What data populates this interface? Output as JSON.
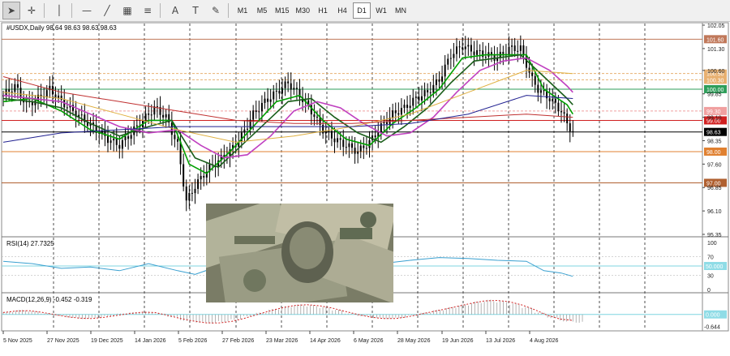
{
  "toolbar": {
    "tools": [
      {
        "icon": "cursor-arrow-icon",
        "glyph": "➤",
        "active": true
      },
      {
        "icon": "crosshair-icon",
        "glyph": "✛",
        "active": false
      },
      {
        "icon": "vertical-line-icon",
        "glyph": "│",
        "active": false
      },
      {
        "icon": "horizontal-line-icon",
        "glyph": "—",
        "active": false
      },
      {
        "icon": "trendline-icon",
        "glyph": "╱",
        "active": false
      },
      {
        "icon": "channel-icon",
        "glyph": "▦",
        "active": false
      },
      {
        "icon": "fibonacci-icon",
        "glyph": "≡",
        "active": false
      },
      {
        "icon": "text-icon",
        "glyph": "A",
        "active": false
      },
      {
        "icon": "text-label-icon",
        "glyph": "T",
        "active": false
      },
      {
        "icon": "shapes-icon",
        "glyph": "✎",
        "active": false
      }
    ],
    "timeframes": [
      {
        "label": "M1",
        "active": false
      },
      {
        "label": "M5",
        "active": false
      },
      {
        "label": "M15",
        "active": false
      },
      {
        "label": "M30",
        "active": false
      },
      {
        "label": "H1",
        "active": false
      },
      {
        "label": "H4",
        "active": false
      },
      {
        "label": "D1",
        "active": true
      },
      {
        "label": "W1",
        "active": false
      },
      {
        "label": "MN",
        "active": false
      }
    ]
  },
  "chart_data": [
    {
      "type": "line",
      "title": "#USDX,Daily  98.64 98.63 98.63 98.63",
      "ylim": [
        95.35,
        102.05
      ],
      "yticks": [
        95.35,
        96.1,
        96.85,
        97.6,
        98.35,
        99.1,
        99.85,
        100.6,
        101.3,
        102.05
      ],
      "price_markers": [
        {
          "value": 101.6,
          "label": "101.60",
          "color": "#c0785a"
        },
        {
          "value": 100.5,
          "label": "100.50",
          "color": "#e8b070"
        },
        {
          "value": 100.3,
          "label": "100.30",
          "color": "#e8b070"
        },
        {
          "value": 100.0,
          "label": "100.00",
          "color": "#2e9e5a"
        },
        {
          "value": 99.3,
          "label": "99.30",
          "color": "#f0a0a0"
        },
        {
          "value": 99.0,
          "label": "99.00",
          "color": "#d02020"
        },
        {
          "value": 98.63,
          "label": "98.63",
          "color": "#000000"
        },
        {
          "value": 98.0,
          "label": "98.00",
          "color": "#e08030"
        },
        {
          "value": 97.0,
          "label": "97.00",
          "color": "#b06030"
        }
      ],
      "x_labels": [
        "5 Nov 2025",
        "27 Nov 2025",
        "19 Dec 2025",
        "14 Jan 2026",
        "5 Feb 2026",
        "27 Feb 2026",
        "23 Mar 2026",
        "14 Apr 2026",
        "6 May 2026",
        "28 May 2026",
        "19 Jun 2026",
        "13 Jul 2026",
        "4 Aug 2026"
      ],
      "close_path": [
        [
          0,
          99.8
        ],
        [
          4,
          100.1
        ],
        [
          8,
          99.5
        ],
        [
          12,
          99.7
        ],
        [
          16,
          100.0
        ],
        [
          20,
          99.6
        ],
        [
          24,
          99.3
        ],
        [
          28,
          99.0
        ],
        [
          32,
          98.7
        ],
        [
          36,
          98.4
        ],
        [
          40,
          98.2
        ],
        [
          44,
          98.6
        ],
        [
          48,
          99.0
        ],
        [
          52,
          99.4
        ],
        [
          56,
          99.1
        ],
        [
          60,
          98.2
        ],
        [
          63,
          96.4
        ],
        [
          66,
          96.9
        ],
        [
          70,
          97.4
        ],
        [
          74,
          97.7
        ],
        [
          78,
          98.0
        ],
        [
          82,
          98.5
        ],
        [
          86,
          99.2
        ],
        [
          90,
          99.6
        ],
        [
          94,
          99.9
        ],
        [
          98,
          100.2
        ],
        [
          102,
          99.8
        ],
        [
          106,
          99.3
        ],
        [
          110,
          98.7
        ],
        [
          114,
          98.4
        ],
        [
          118,
          98.2
        ],
        [
          122,
          98.0
        ],
        [
          126,
          98.3
        ],
        [
          130,
          98.8
        ],
        [
          134,
          99.2
        ],
        [
          138,
          99.4
        ],
        [
          142,
          99.7
        ],
        [
          146,
          99.9
        ],
        [
          150,
          100.3
        ],
        [
          154,
          101.1
        ],
        [
          158,
          101.4
        ],
        [
          162,
          101.2
        ],
        [
          166,
          101.1
        ],
        [
          170,
          101.0
        ],
        [
          174,
          101.3
        ],
        [
          178,
          101.3
        ],
        [
          182,
          100.3
        ],
        [
          184,
          100.0
        ],
        [
          188,
          99.7
        ],
        [
          192,
          99.3
        ],
        [
          194,
          98.9
        ],
        [
          196,
          98.63
        ]
      ],
      "series": [
        {
          "key": "ma_fast",
          "color": "#00a000",
          "values": [
            [
              0,
              99.6
            ],
            [
              10,
              99.7
            ],
            [
              20,
              99.3
            ],
            [
              30,
              98.7
            ],
            [
              40,
              98.4
            ],
            [
              50,
              99.0
            ],
            [
              58,
              99.0
            ],
            [
              64,
              97.6
            ],
            [
              70,
              97.3
            ],
            [
              78,
              98.0
            ],
            [
              86,
              98.8
            ],
            [
              94,
              99.6
            ],
            [
              102,
              99.8
            ],
            [
              110,
              99.0
            ],
            [
              118,
              98.4
            ],
            [
              126,
              98.2
            ],
            [
              134,
              98.9
            ],
            [
              142,
              99.4
            ],
            [
              150,
              100.0
            ],
            [
              158,
              101.0
            ],
            [
              166,
              101.1
            ],
            [
              174,
              101.1
            ],
            [
              180,
              101.1
            ],
            [
              186,
              100.0
            ],
            [
              194,
              99.5
            ],
            [
              196,
              99.2
            ]
          ]
        },
        {
          "key": "ma_mid",
          "color": "#1a5e1a",
          "values": [
            [
              0,
              99.7
            ],
            [
              10,
              99.6
            ],
            [
              20,
              99.4
            ],
            [
              30,
              98.9
            ],
            [
              40,
              98.5
            ],
            [
              50,
              98.8
            ],
            [
              58,
              99.0
            ],
            [
              66,
              97.8
            ],
            [
              74,
              97.5
            ],
            [
              82,
              98.2
            ],
            [
              90,
              98.9
            ],
            [
              98,
              99.6
            ],
            [
              106,
              99.7
            ],
            [
              114,
              99.1
            ],
            [
              122,
              98.6
            ],
            [
              130,
              98.3
            ],
            [
              138,
              98.8
            ],
            [
              146,
              99.4
            ],
            [
              154,
              100.2
            ],
            [
              162,
              100.9
            ],
            [
              170,
              101.0
            ],
            [
              178,
              101.1
            ],
            [
              186,
              100.4
            ],
            [
              194,
              99.7
            ],
            [
              196,
              99.5
            ]
          ]
        },
        {
          "key": "ma_slow",
          "color": "#c040c0",
          "values": [
            [
              0,
              99.8
            ],
            [
              10,
              99.7
            ],
            [
              20,
              99.6
            ],
            [
              30,
              99.2
            ],
            [
              40,
              98.8
            ],
            [
              50,
              98.6
            ],
            [
              60,
              98.7
            ],
            [
              68,
              98.2
            ],
            [
              76,
              97.8
            ],
            [
              84,
              97.9
            ],
            [
              92,
              98.5
            ],
            [
              100,
              99.3
            ],
            [
              108,
              99.6
            ],
            [
              116,
              99.4
            ],
            [
              124,
              98.9
            ],
            [
              132,
              98.5
            ],
            [
              140,
              98.6
            ],
            [
              148,
              99.1
            ],
            [
              156,
              99.9
            ],
            [
              164,
              100.6
            ],
            [
              172,
              100.9
            ],
            [
              180,
              101.0
            ],
            [
              188,
              100.6
            ],
            [
              194,
              100.1
            ],
            [
              196,
              99.9
            ]
          ]
        },
        {
          "key": "ma_100",
          "color": "#e0b040",
          "values": [
            [
              0,
              99.9
            ],
            [
              20,
              99.7
            ],
            [
              40,
              99.2
            ],
            [
              60,
              98.7
            ],
            [
              80,
              98.3
            ],
            [
              100,
              98.5
            ],
            [
              120,
              98.8
            ],
            [
              140,
              99.2
            ],
            [
              160,
              99.9
            ],
            [
              180,
              100.6
            ],
            [
              196,
              100.5
            ]
          ]
        },
        {
          "key": "ma_200",
          "color": "#c03030",
          "values": [
            [
              0,
              100.4
            ],
            [
              20,
              99.9
            ],
            [
              40,
              99.6
            ],
            [
              60,
              99.3
            ],
            [
              80,
              99.0
            ],
            [
              100,
              98.9
            ],
            [
              120,
              98.9
            ],
            [
              140,
              99.0
            ],
            [
              160,
              99.1
            ],
            [
              180,
              99.2
            ],
            [
              196,
              99.1
            ]
          ]
        },
        {
          "key": "ma_long",
          "color": "#202090",
          "values": [
            [
              0,
              98.3
            ],
            [
              20,
              98.6
            ],
            [
              40,
              98.7
            ],
            [
              60,
              98.8
            ],
            [
              80,
              98.8
            ],
            [
              100,
              98.8
            ],
            [
              120,
              98.8
            ],
            [
              140,
              98.9
            ],
            [
              160,
              99.2
            ],
            [
              180,
              99.8
            ],
            [
              196,
              99.7
            ]
          ]
        }
      ]
    },
    {
      "type": "line",
      "title": "RSI(14) 27.7325",
      "ylim": [
        0,
        100
      ],
      "yticks": [
        0,
        30,
        70,
        100
      ],
      "level": {
        "value": 50,
        "label": "50.000"
      },
      "series": [
        {
          "key": "rsi",
          "color": "#3aa0d0",
          "values": [
            [
              0,
              60
            ],
            [
              10,
              55
            ],
            [
              20,
              45
            ],
            [
              30,
              48
            ],
            [
              40,
              40
            ],
            [
              50,
              55
            ],
            [
              60,
              40
            ],
            [
              66,
              32
            ],
            [
              72,
              45
            ],
            [
              80,
              55
            ],
            [
              90,
              62
            ],
            [
              100,
              60
            ],
            [
              110,
              45
            ],
            [
              120,
              40
            ],
            [
              130,
              55
            ],
            [
              140,
              62
            ],
            [
              150,
              68
            ],
            [
              160,
              66
            ],
            [
              170,
              62
            ],
            [
              180,
              60
            ],
            [
              186,
              40
            ],
            [
              192,
              35
            ],
            [
              196,
              28
            ]
          ]
        }
      ]
    },
    {
      "type": "bar",
      "title": "MACD(12,26,9) -0.452 -0.319",
      "ylim": [
        -0.75,
        0.9
      ],
      "yticks": [
        -0.644
      ],
      "level": {
        "value": 0,
        "label": "0.000"
      },
      "histogram": [
        0.15,
        0.25,
        0.18,
        0.05,
        -0.08,
        -0.18,
        -0.25,
        -0.2,
        -0.1,
        0.05,
        0.12,
        0.15,
        0.05,
        -0.15,
        -0.35,
        -0.45,
        -0.5,
        -0.42,
        -0.3,
        -0.1,
        0.1,
        0.3,
        0.45,
        0.55,
        0.5,
        0.4,
        0.25,
        0.05,
        -0.1,
        -0.2,
        -0.25,
        -0.2,
        -0.05,
        0.1,
        0.25,
        0.4,
        0.55,
        0.7,
        0.8,
        0.75,
        0.6,
        0.4,
        0.1,
        -0.2,
        -0.38,
        -0.45
      ],
      "signal": [
        0.1,
        0.18,
        0.2,
        0.12,
        0.0,
        -0.12,
        -0.2,
        -0.22,
        -0.15,
        -0.05,
        0.05,
        0.12,
        0.1,
        -0.05,
        -0.22,
        -0.35,
        -0.45,
        -0.46,
        -0.38,
        -0.22,
        -0.02,
        0.18,
        0.35,
        0.48,
        0.52,
        0.46,
        0.34,
        0.16,
        0.0,
        -0.14,
        -0.22,
        -0.22,
        -0.12,
        0.02,
        0.16,
        0.3,
        0.45,
        0.6,
        0.72,
        0.75,
        0.68,
        0.5,
        0.25,
        -0.05,
        -0.25,
        -0.32
      ]
    }
  ],
  "colors": {
    "grid": "#222222",
    "axis_text": "#222222",
    "current_price": "#000000"
  }
}
